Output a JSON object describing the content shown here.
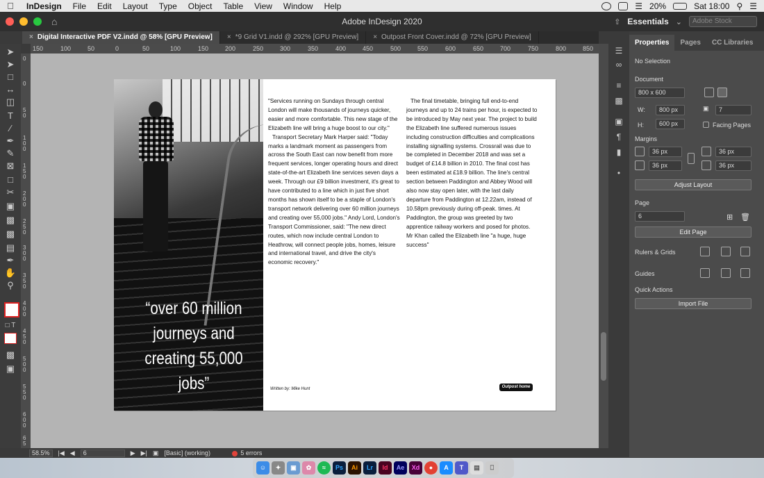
{
  "menubar": {
    "app": "InDesign",
    "items": [
      "File",
      "Edit",
      "Layout",
      "Type",
      "Object",
      "Table",
      "View",
      "Window",
      "Help"
    ],
    "battery": "20%",
    "clock": "Sat 18:00"
  },
  "window": {
    "title": "Adobe InDesign 2020",
    "workspace": "Essentials",
    "stock_placeholder": "Adobe Stock"
  },
  "tabs": [
    {
      "label": "Digital Interactive PDF V2.indd @ 58% [GPU Preview]"
    },
    {
      "label": "*9 Grid V1.indd @ 292% [GPU Preview]"
    },
    {
      "label": "Outpost Front Cover.indd @ 72% [GPU Preview]"
    }
  ],
  "ruler": {
    "h": [
      "150",
      "100",
      "50",
      "0",
      "50",
      "100",
      "150",
      "200",
      "250",
      "300",
      "350",
      "400",
      "450",
      "500",
      "550",
      "600",
      "650",
      "700",
      "750",
      "800",
      "850"
    ],
    "v": [
      "0",
      "0",
      "50",
      "100",
      "150",
      "200",
      "250",
      "300",
      "350",
      "400",
      "450",
      "500",
      "550",
      "600",
      "65"
    ]
  },
  "document": {
    "quote": "“over 60 million journeys and creating 55,000 jobs”",
    "col1": [
      "\"Services running on Sundays through central London will make thousands of journeys quicker, easier and more comfortable. This new stage of the Elizabeth line will bring a huge boost to our city.\"",
      "Transport Secretary Mark Harper said: \"Today marks a landmark moment as passengers from across the South East can now benefit from more frequent services, longer operating hours and direct state-of-the-art Elizabeth line services seven days a week. Through our £9 billion investment, it's great to have contributed to a line which in just five short months has shown itself to be a staple of London's transport network delivering over 60 million journeys and creating over 55,000 jobs.\" Andy Lord, London's Transport Commissioner, said: \"The new direct routes, which now include central London to Heathrow, will connect people jobs, homes, leisure and international travel, and drive the city's economic recovery.\""
    ],
    "col2": [
      "The final timetable, bringing full end-to-end journeys and up to 24 trains per hour, is expected to be introduced by May next year. The project to build the Elizabeth line suffered numerous issues including construction difficulties and complications installing signalling systems. Crossrail was due to be completed in December 2018 and was set a budget of £14.8 billion in 2010. The final cost has been estimated at £18.9 billion. The line's central section between Paddington and Abbey Wood will also now stay open later, with the last daily departure from Paddington at 12.22am, instead of 10.58pm previously during off-peak. times. At Paddington, the group was greeted by two apprentice railway workers and posed for photos. Mr Khan called the Elizabeth line \"a huge, huge success\""
    ],
    "byline": "Written by: Mike Hunt",
    "brand": "Outpost home"
  },
  "status": {
    "zoom": "58.5%",
    "page": "6",
    "style": "[Basic] (working)",
    "errors": "5 errors"
  },
  "panel": {
    "tabs": [
      "Properties",
      "Pages",
      "CC Libraries"
    ],
    "selection": "No Selection",
    "document_label": "Document",
    "preset": "800 x 600",
    "w_label": "W:",
    "w": "800 px",
    "h_label": "H:",
    "h": "600 px",
    "pages_count": "7",
    "facing": "Facing Pages",
    "margins_label": "Margins",
    "m_top": "36 px",
    "m_bottom": "36 px",
    "m_left": "36 px",
    "m_right": "36 px",
    "adjust": "Adjust Layout",
    "page_label": "Page",
    "page_value": "6",
    "edit_page": "Edit Page",
    "rulers": "Rulers & Grids",
    "guides": "Guides",
    "quick": "Quick Actions",
    "import": "Import File"
  },
  "dock": [
    "Ps",
    "Ai",
    "Lr",
    "Id",
    "Ae",
    "Xd"
  ]
}
